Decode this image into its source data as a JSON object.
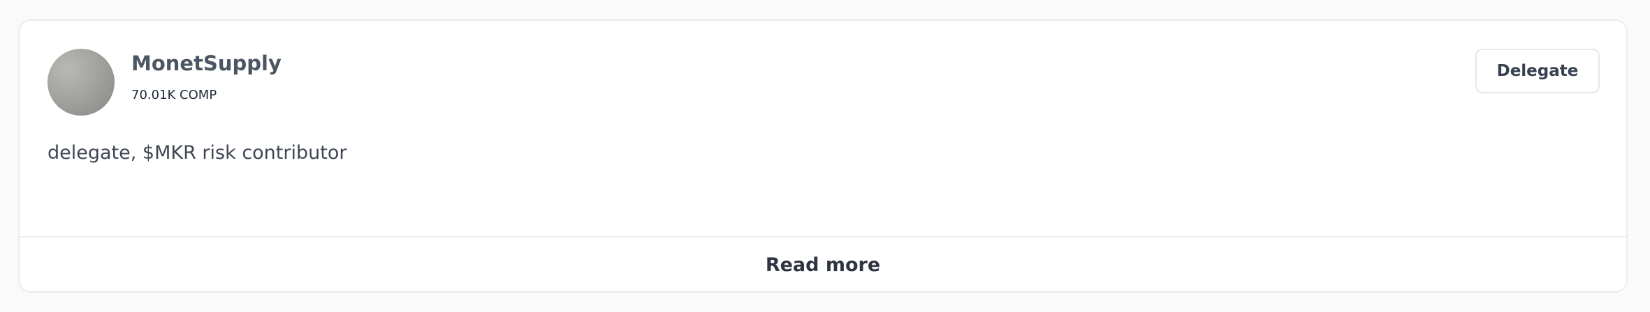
{
  "delegate": {
    "name": "MonetSupply",
    "voting_power": "70.01K COMP",
    "bio": "delegate, $MKR risk contributor",
    "delegate_label": "Delegate",
    "read_more_label": "Read more"
  },
  "colors": {
    "card_background": "#ffffff",
    "page_background": "#fafafa",
    "avatar_gray": "#a3a3a0",
    "text": "#334155"
  }
}
